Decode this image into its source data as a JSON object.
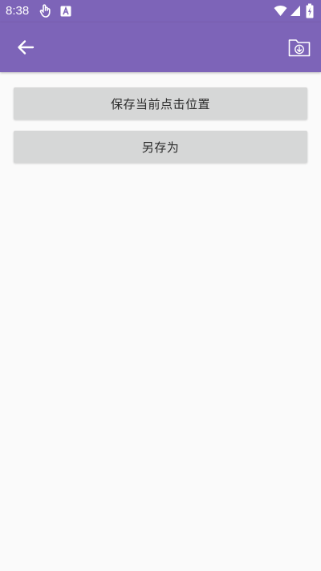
{
  "status_bar": {
    "time": "8:38",
    "icons": [
      "touch-icon",
      "text-a-icon",
      "wifi-icon",
      "signal-icon",
      "battery-icon"
    ]
  },
  "app_bar": {
    "back_icon": "arrow-left-icon",
    "action_icon": "folder-download-icon",
    "color": "#7d64b8"
  },
  "buttons": {
    "save_current": "保存当前点击位置",
    "save_as": "另存为"
  },
  "colors": {
    "accent": "#7d64b8",
    "button_bg": "#d6d7d7",
    "page_bg": "#fafafa"
  }
}
